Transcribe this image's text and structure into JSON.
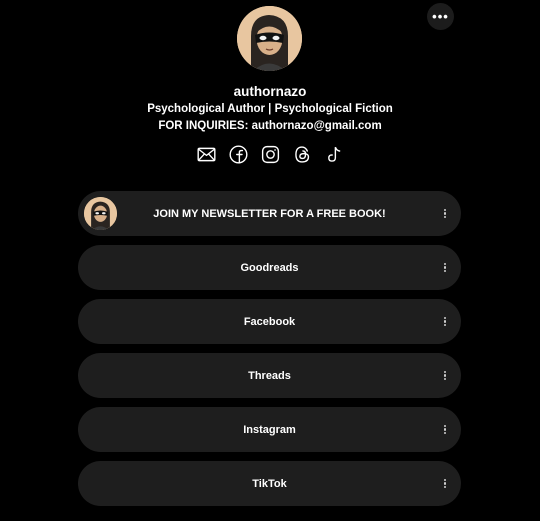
{
  "profile": {
    "username": "authornazo",
    "bio_line1": "Psychological Author | Psychological Fiction",
    "bio_line2": "FOR INQUIRIES: authornazo@gmail.com",
    "more_label": "•••"
  },
  "socials": [
    {
      "icon": "mail-icon"
    },
    {
      "icon": "facebook-icon"
    },
    {
      "icon": "instagram-icon"
    },
    {
      "icon": "threads-icon"
    },
    {
      "icon": "tiktok-icon"
    }
  ],
  "links": [
    {
      "label": "JOIN MY NEWSLETTER FOR A FREE BOOK!",
      "has_thumb": true
    },
    {
      "label": "Goodreads"
    },
    {
      "label": "Facebook"
    },
    {
      "label": "Threads"
    },
    {
      "label": "Instagram"
    },
    {
      "label": "TikTok"
    }
  ],
  "colors": {
    "background": "#000000",
    "link_bg": "#1e1e1e",
    "text": "#ffffff"
  }
}
